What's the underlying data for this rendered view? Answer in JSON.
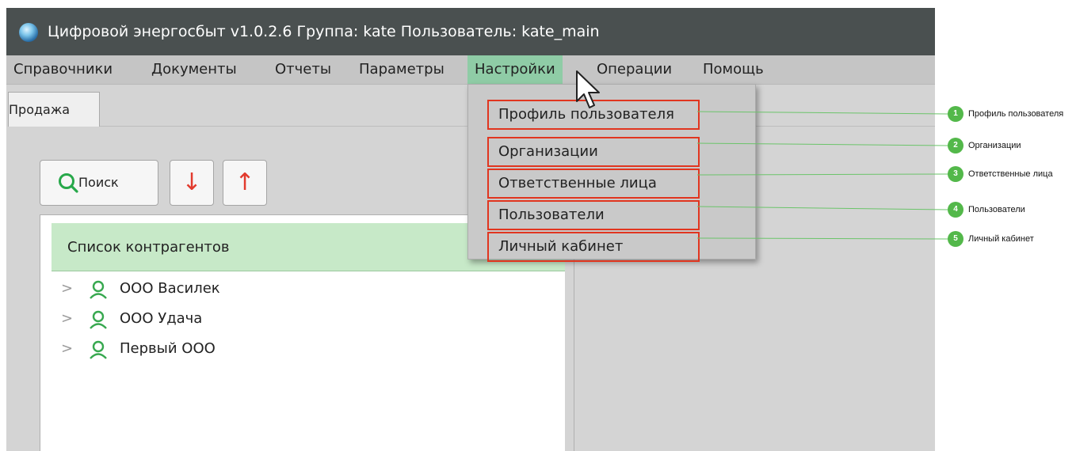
{
  "window": {
    "title": "Цифровой энергосбыт v1.0.2.6 Группа: kate Пользователь: kate_main"
  },
  "menubar": {
    "items": [
      "Справочники",
      "Документы",
      "Отчеты",
      "Параметры",
      "Настройки",
      "Операции",
      "Помощь"
    ],
    "active": "Настройки"
  },
  "tabs": {
    "active": "Продажа"
  },
  "toolbar": {
    "search_label": "Поиск",
    "down_icon": "arrow-down",
    "up_icon": "arrow-up"
  },
  "panel": {
    "header": "Список контрагентов",
    "items": [
      "ООО Василек",
      "ООО Удача",
      "Первый ООО"
    ]
  },
  "dropdown": {
    "items": [
      "Профиль пользователя",
      "Организации",
      "Ответственные лица",
      "Пользователи",
      "Личный кабинет"
    ]
  },
  "callouts": [
    {
      "number": "1",
      "label": "Профиль пользователя"
    },
    {
      "number": "2",
      "label": "Организации"
    },
    {
      "number": "3",
      "label": "Ответственные лица"
    },
    {
      "number": "4",
      "label": "Пользователи"
    },
    {
      "number": "5",
      "label": "Личный кабинет"
    }
  ],
  "colors": {
    "titlebar": "#4a5050",
    "menu_active": "#8fcca6",
    "panel_header": "#c7e9c8",
    "highlight_border": "#e1351f",
    "badge": "#53b84a",
    "arrow": "#e23b2e"
  }
}
